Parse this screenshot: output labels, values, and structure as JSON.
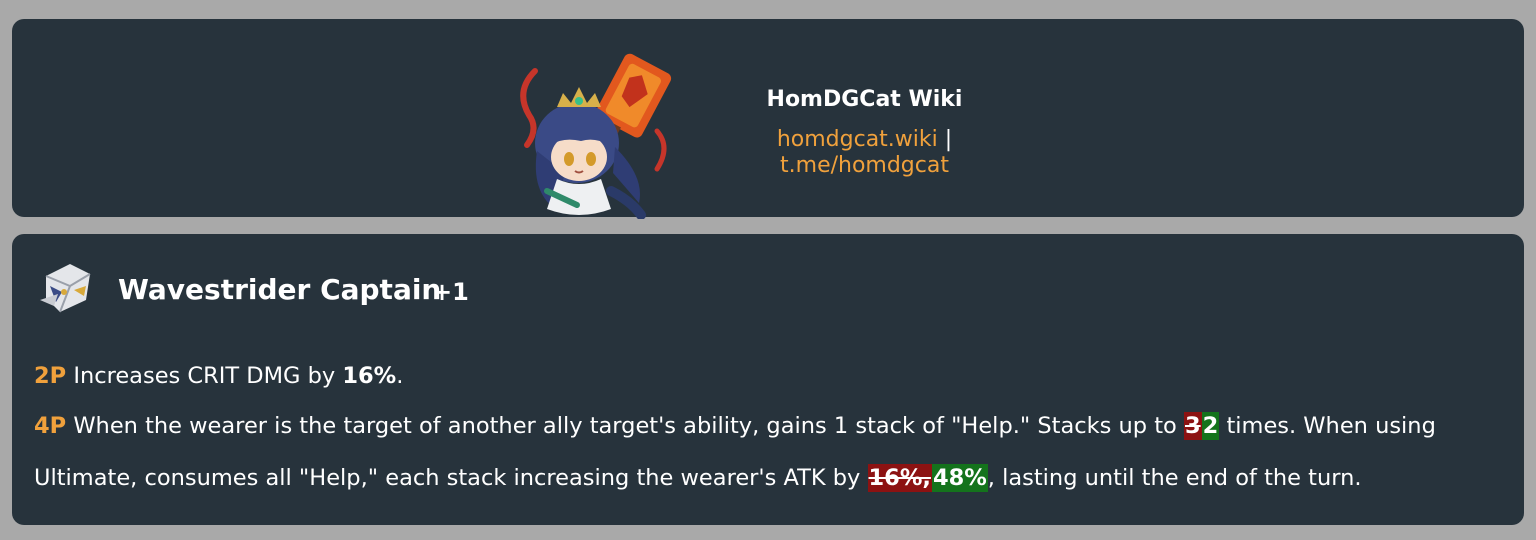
{
  "header": {
    "title": "HomDGCat Wiki",
    "link_site": "homdgcat.wiki",
    "separator": "|",
    "link_telegram": "t.me/homdgcat",
    "mascot_icon": "chibi-mascot-icon"
  },
  "relic_set": {
    "icon": "wavestrider-captain-set-icon",
    "name": "Wavestrider Captain",
    "plus": "+1",
    "effect_2p": {
      "label": "2P",
      "text_before": "Increases CRIT DMG by ",
      "value": "16%",
      "text_after": "."
    },
    "effect_4p": {
      "label": "4P",
      "text_part1": "When the wearer is the target of another ally target's ability, gains 1 stack of \"Help.\" Stacks up to ",
      "stacks_old": "3",
      "stacks_new": "2",
      "text_part2": " times. When using Ultimate, consumes all \"Help,\" each stack increasing the wearer's ATK by ",
      "atk_old": "16%,",
      "atk_new": "48%",
      "text_part3": ", lasting until the end of the turn."
    }
  },
  "colors": {
    "page_bg": "#a9a9a9",
    "card_bg": "#27333c",
    "accent_orange": "#f0a13c",
    "removed_red": "#8c1212",
    "added_green": "#14731c"
  }
}
